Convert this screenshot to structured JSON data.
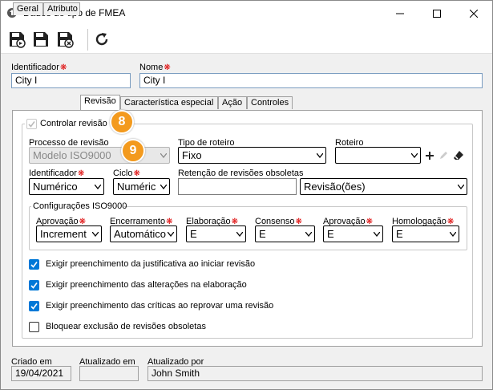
{
  "window": {
    "title": "Dados do tipo de FMEA"
  },
  "header": {
    "identificador_label": "Identificador",
    "identificador_value": "City I",
    "nome_label": "Nome",
    "nome_value": "City I"
  },
  "tabs": [
    {
      "label": "Geral"
    },
    {
      "label": "Atributo"
    },
    {
      "label": "Revisão"
    },
    {
      "label": "Característica especial"
    },
    {
      "label": "Ação"
    },
    {
      "label": "Controles"
    }
  ],
  "revisao": {
    "controlar_label": "Controlar revisão",
    "badge8": "8",
    "badge9": "9",
    "processo_label": "Processo de revisão",
    "processo_value": "Modelo ISO9000",
    "tipo_roteiro_label": "Tipo de roteiro",
    "tipo_roteiro_value": "Fixo",
    "roteiro_label": "Roteiro",
    "roteiro_value": "",
    "identificador_label": "Identificador",
    "identificador_value": "Numérico",
    "ciclo_label": "Ciclo",
    "ciclo_value": "Numéric",
    "retencao_label": "Retenção de revisões obsoletas",
    "retencao_value": "",
    "retencao_unit": "Revisão(ões)",
    "iso_group_label": "Configurações ISO9000",
    "iso": [
      {
        "label": "Aprovação",
        "value": "Increment"
      },
      {
        "label": "Encerramento",
        "value": "Automático"
      },
      {
        "label": "Elaboração",
        "value": "E"
      },
      {
        "label": "Consenso",
        "value": "E"
      },
      {
        "label": "Aprovação",
        "value": "E"
      },
      {
        "label": "Homologação",
        "value": "E"
      }
    ],
    "checks": [
      {
        "label": "Exigir preenchimento da justificativa ao iniciar revisão",
        "checked": true
      },
      {
        "label": "Exigir preenchimento das alterações na elaboração",
        "checked": true
      },
      {
        "label": "Exigir preenchimento das críticas ao reprovar uma revisão",
        "checked": true
      },
      {
        "label": "Bloquear exclusão de revisões obsoletas",
        "checked": false
      }
    ]
  },
  "footer": {
    "criado_label": "Criado em",
    "criado_value": "19/04/2021",
    "atualizado_label": "Atualizado em",
    "atualizado_value": "",
    "atualizado_por_label": "Atualizado por",
    "atualizado_por_value": "John Smith"
  },
  "colors": {
    "accent": "#0078d7",
    "badge": "#f39a1e",
    "required": "#dd0000"
  }
}
